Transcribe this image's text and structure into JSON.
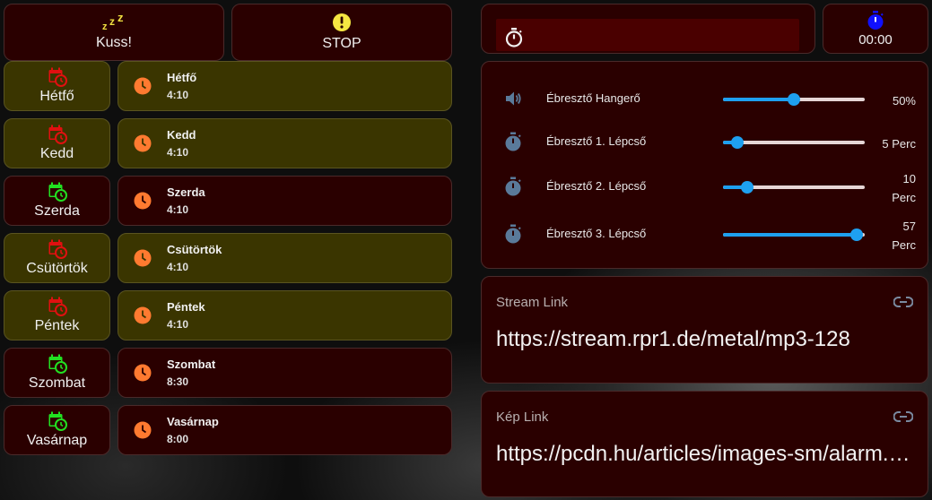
{
  "top_buttons": {
    "kuss": {
      "label": "Kuss!",
      "icon": "sleep-zzz-icon"
    },
    "stop": {
      "label": "STOP",
      "icon": "alert-circle-icon"
    }
  },
  "timer": {
    "time": "00:00",
    "icon": "timer-icon"
  },
  "colors": {
    "enabled_icon": "#22e022",
    "disabled_icon": "#e01010",
    "clock_icon": "#ff7a30",
    "slider_accent": "#1ea0f0",
    "card_red": "#2a0000",
    "card_olive": "#3a3500"
  },
  "days": [
    {
      "label": "Hétfő",
      "enabled": false,
      "alarm_name": "Hétfő",
      "alarm_time": "4:10"
    },
    {
      "label": "Kedd",
      "enabled": false,
      "alarm_name": "Kedd",
      "alarm_time": "4:10"
    },
    {
      "label": "Szerda",
      "enabled": true,
      "alarm_name": "Szerda",
      "alarm_time": "4:10"
    },
    {
      "label": "Csütörtök",
      "enabled": false,
      "alarm_name": "Csütörtök",
      "alarm_time": "4:10"
    },
    {
      "label": "Péntek",
      "enabled": false,
      "alarm_name": "Péntek",
      "alarm_time": "4:10"
    },
    {
      "label": "Szombat",
      "enabled": true,
      "alarm_name": "Szombat",
      "alarm_time": "8:30"
    },
    {
      "label": "Vasárnap",
      "enabled": true,
      "alarm_name": "Vasárnap",
      "alarm_time": "8:00"
    }
  ],
  "settings": {
    "volume": {
      "name": "Ébresztő Hangerő",
      "value_text": "50%",
      "fraction": 0.5,
      "icon": "volume-icon"
    },
    "step1": {
      "name": "Ébresztő 1. Lépcső",
      "value_text": "5 Perc",
      "fraction": 0.1,
      "icon": "timer-icon"
    },
    "step2": {
      "name": "Ébresztő 2. Lépcső",
      "value_line1": "10",
      "value_line2": "Perc",
      "fraction": 0.17,
      "icon": "timer-icon"
    },
    "step3": {
      "name": "Ébresztő 3. Lépcső",
      "value_line1": "57",
      "value_line2": "Perc",
      "fraction": 0.94,
      "icon": "timer-icon"
    }
  },
  "stream_link": {
    "title": "Stream Link",
    "url": "https://stream.rpr1.de/metal/mp3-128",
    "icon": "link-icon"
  },
  "image_link": {
    "title": "Kép Link",
    "url": "https://pcdn.hu/articles/images-sm/alarm.jpg",
    "icon": "link-icon"
  }
}
